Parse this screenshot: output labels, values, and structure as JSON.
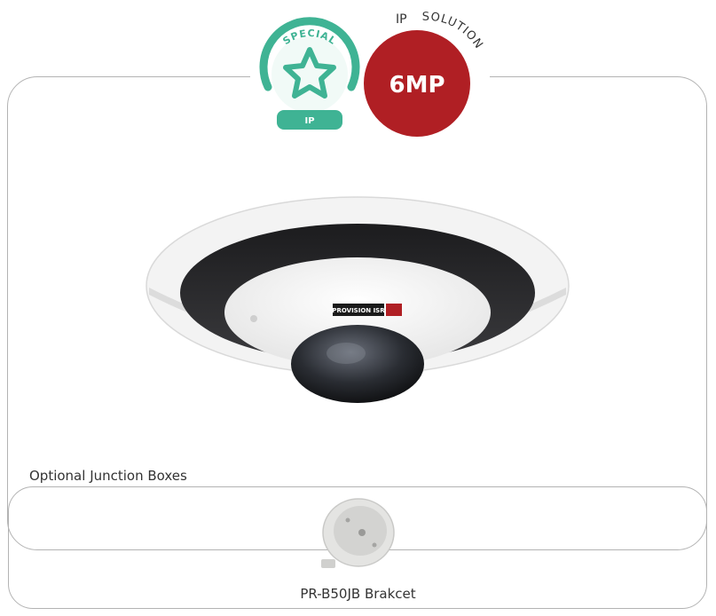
{
  "badges": {
    "special_text": "SPECIAL",
    "special_sub": "IP",
    "mp_value": "6MP",
    "arc_ip": "IP",
    "arc_solution": "SOLUTION"
  },
  "product": {
    "brand_label": "PROVISION ISR"
  },
  "accessories": {
    "section_label": "Optional Junction Boxes",
    "item_label": "PR-B50JB Brakcet"
  },
  "colors": {
    "badge_green": "#3fb394",
    "badge_red": "#b01f24",
    "frame_border": "#b3b3b3"
  }
}
